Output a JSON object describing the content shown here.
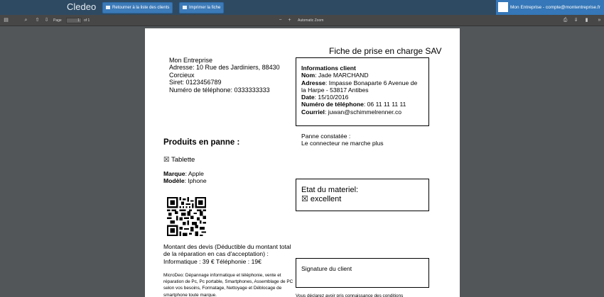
{
  "navbar": {
    "brand": "Cledeo",
    "back_button": "Retourner à la liste des clients",
    "print_button": "Imprimer la fiche",
    "account": "Mon Entreprise - compte@montentreprise.fr"
  },
  "pdf_toolbar": {
    "page_label": "Page",
    "page_value": "1",
    "page_of": "of 1",
    "zoom": "Automatic Zoom"
  },
  "document": {
    "title": "Fiche de prise en charge SAV",
    "company": {
      "name": "Mon Entreprise",
      "address": "Adresse: 10 Rue des Jardiniers, 88430",
      "city": "Corcieux",
      "siret": "Siret: 0123456789",
      "phone": "Numéro de téléphone: 0333333333"
    },
    "client": {
      "heading": "Informations client",
      "name_label": "Nom",
      "name": ": Jade MARCHAND",
      "address_label": "Adresse",
      "address": ": Impasse Bonaparte 6 Avenue de la Harpe - 53817 Antibes",
      "date_label": "Date",
      "date": ": 15/10/2016",
      "phone_label": "Numéro de téléphone",
      "phone": ": 06 11 11 11 11",
      "email_label": "Courriel",
      "email": ": juwan@schimmelrenner.co"
    },
    "panne": {
      "label": "Panne constatée :",
      "value": "Le connecteur ne marche plus"
    },
    "produits_heading": "Produits en panne :",
    "product_type": "☒ Tablette",
    "marque_label": "Marque",
    "marque": ": Apple",
    "modele_label": "Modèle",
    "modele": ": Iphone",
    "etat": {
      "label": "Etat du materiel:",
      "value": "☒ excellent"
    },
    "devis": {
      "text": "Montant des devis (Déductible du montant total de la réparation en cas d'acceptation) :",
      "amounts": "Informatique : 39 €  Téléphonie : 19€"
    },
    "microdeo": "MicroDeo: Dépannage informatique et téléphonie, vente et réparation de Pc, Pc portable, Smartphones, Assemblage de PC selon vos besoins, Formatage, Nettoyage et Déblocage de smartphone toute marque.",
    "signature_label": "Signature du client",
    "bottom_text": "Vous déclarez avoir pris connaissance des conditions"
  },
  "colors": {
    "navbar": "#2e4a62",
    "button": "#3c7ab8",
    "account": "#3577b8",
    "viewer_bg": "#525659"
  }
}
